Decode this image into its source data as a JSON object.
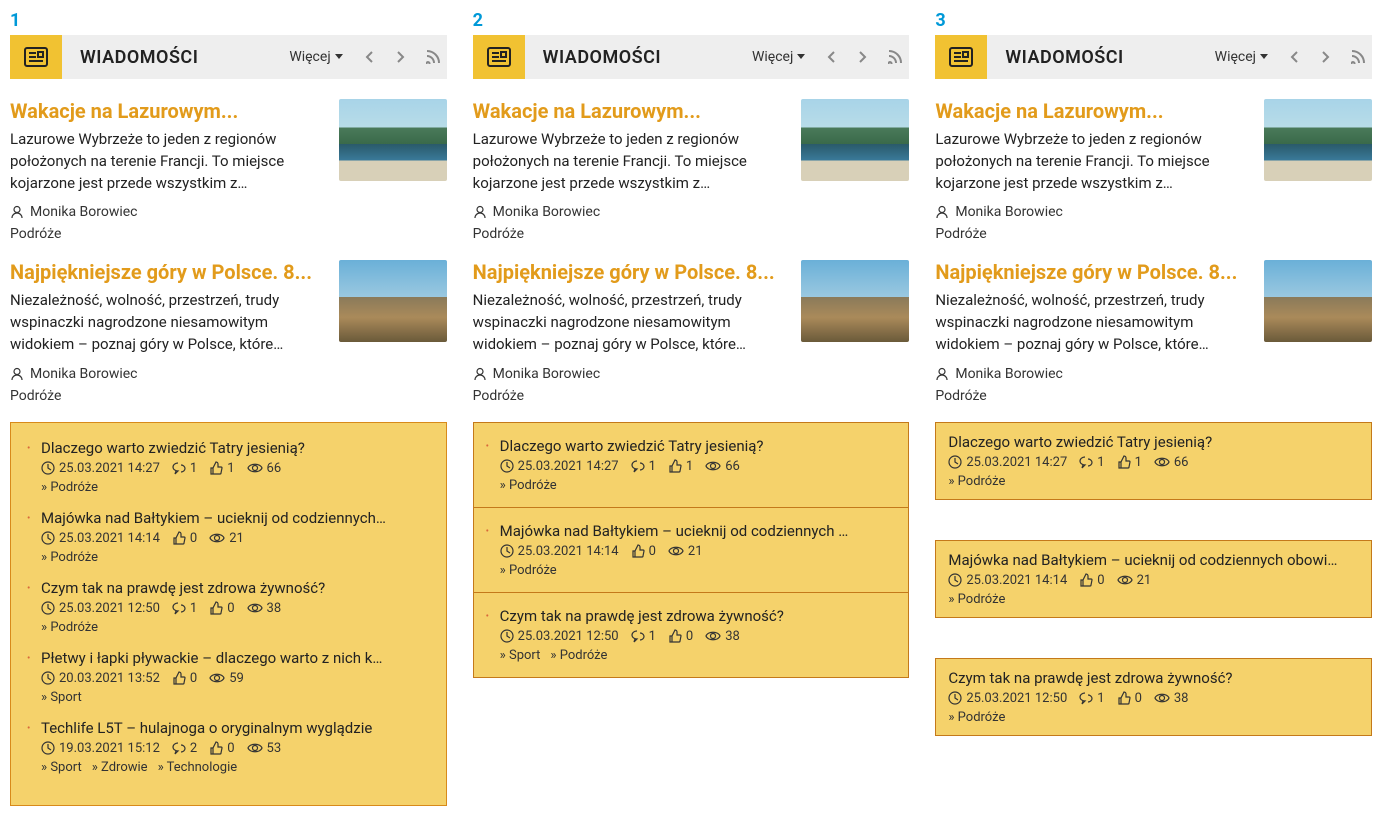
{
  "col_nums": [
    "1",
    "2",
    "3"
  ],
  "header": {
    "title": "WIADOMOŚCI",
    "more": "Więcej"
  },
  "articles": [
    {
      "title": "Wakacje na Lazurowym...",
      "body": "Lazurowe Wybrzeże to jeden z regionów położonych na terenie Francji. To miejsce kojarzone jest przede wszystkim z…",
      "author": "Monika Borowiec",
      "category": "Podróże"
    },
    {
      "title": "Najpiękniejsze góry w Polsce. 8...",
      "body": "Niezależność, wolność, przestrzeń, trudy wspinaczki nagrodzone niesamowitym widokiem – poznaj góry w Polsce, które…",
      "author": "Monika Borowiec",
      "category": "Podróże"
    }
  ],
  "list_v1": [
    {
      "title": "Dlaczego warto zwiedzić Tatry jesienią?",
      "time": "25.03.2021 14:27",
      "comments": "1",
      "likes": "1",
      "views": "66",
      "cats": [
        "» Podróże"
      ]
    },
    {
      "title": "Majówka nad Bałtykiem – ucieknij od codziennych…",
      "time": "25.03.2021 14:14",
      "comments": "",
      "likes": "0",
      "views": "21",
      "cats": [
        "» Podróże"
      ]
    },
    {
      "title": "Czym tak na prawdę jest zdrowa żywność?",
      "time": "25.03.2021 12:50",
      "comments": "1",
      "likes": "0",
      "views": "38",
      "cats": [
        "» Podróże"
      ]
    },
    {
      "title": "Płetwy i łapki pływackie – dlaczego warto z nich k…",
      "time": "20.03.2021 13:52",
      "comments": "",
      "likes": "0",
      "views": "59",
      "cats": [
        "» Sport"
      ]
    },
    {
      "title": "Techlife L5T – hulajnoga o oryginalnym wyglądzie",
      "time": "19.03.2021 15:12",
      "comments": "2",
      "likes": "0",
      "views": "53",
      "cats": [
        "» Sport",
        "» Zdrowie",
        "» Technologie"
      ]
    }
  ],
  "list_v2": [
    {
      "title": "Dlaczego warto zwiedzić Tatry jesienią?",
      "time": "25.03.2021 14:27",
      "comments": "1",
      "likes": "1",
      "views": "66",
      "cats": [
        "» Podróże"
      ]
    },
    {
      "title": "Majówka nad Bałtykiem – ucieknij od codziennych …",
      "time": "25.03.2021 14:14",
      "comments": "",
      "likes": "0",
      "views": "21",
      "cats": [
        "» Podróże"
      ]
    },
    {
      "title": "Czym tak na prawdę jest zdrowa żywność?",
      "time": "25.03.2021 12:50",
      "comments": "1",
      "likes": "0",
      "views": "38",
      "cats": [
        "» Sport",
        "» Podróże"
      ]
    }
  ],
  "list_v3": [
    {
      "title": "Dlaczego warto zwiedzić Tatry jesienią?",
      "time": "25.03.2021 14:27",
      "comments": "1",
      "likes": "1",
      "views": "66",
      "cats": [
        "» Podróże"
      ]
    },
    {
      "title": "Majówka nad Bałtykiem – ucieknij od codziennych obowi…",
      "time": "25.03.2021 14:14",
      "comments": "",
      "likes": "0",
      "views": "21",
      "cats": [
        "» Podróże"
      ]
    },
    {
      "title": "Czym tak na prawdę jest zdrowa żywność?",
      "time": "25.03.2021 12:50",
      "comments": "1",
      "likes": "0",
      "views": "38",
      "cats": [
        "» Podróże"
      ]
    }
  ]
}
